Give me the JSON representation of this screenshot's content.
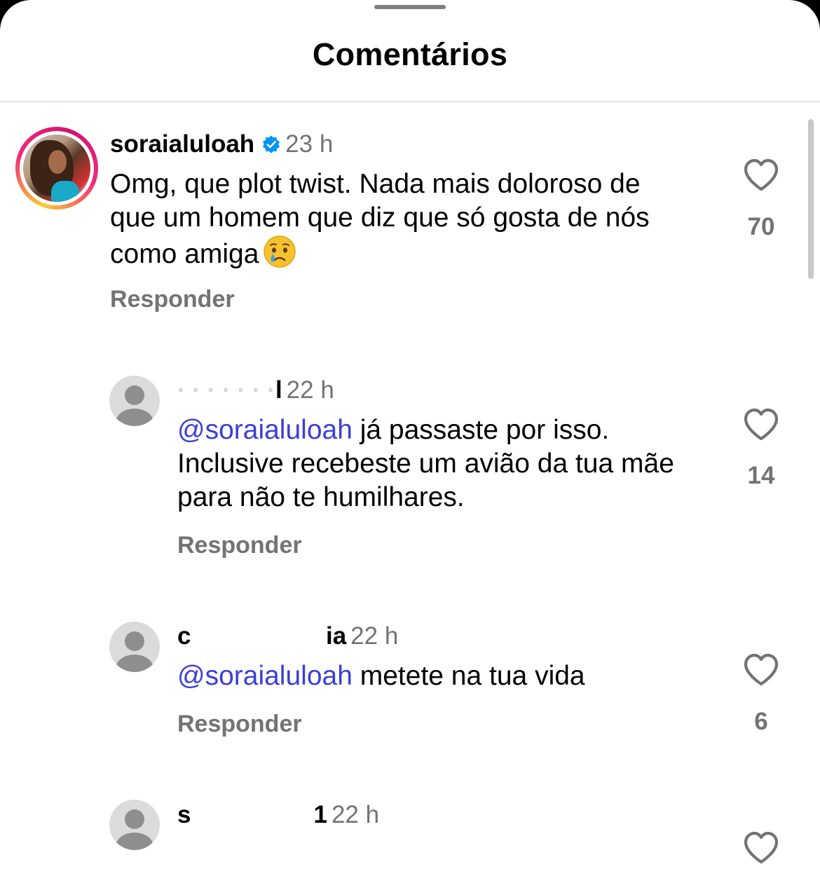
{
  "header": {
    "title": "Comentários"
  },
  "comments": [
    {
      "username": "soraialuloah",
      "verified": true,
      "time": "23 h",
      "text": "Omg, que plot twist. Nada mais doloroso de que um homem que diz que só gosta de nós como amiga",
      "emoji": "crying-face",
      "reply_label": "Responder",
      "likes": "70"
    },
    {
      "username_visible": "l",
      "time": "22 h",
      "mention": "@soraialuloah",
      "text": " já passaste por isso. Inclusive recebeste um avião  da tua mãe  para não  te humilhares.",
      "reply_label": "Responder",
      "likes": "14"
    },
    {
      "username_start": "c",
      "username_end": "ia",
      "time": "22 h",
      "mention": "@soraialuloah",
      "text": " metete na tua vida",
      "reply_label": "Responder",
      "likes": "6"
    },
    {
      "username_start": "s",
      "username_end": "1",
      "time": "22 h"
    }
  ]
}
